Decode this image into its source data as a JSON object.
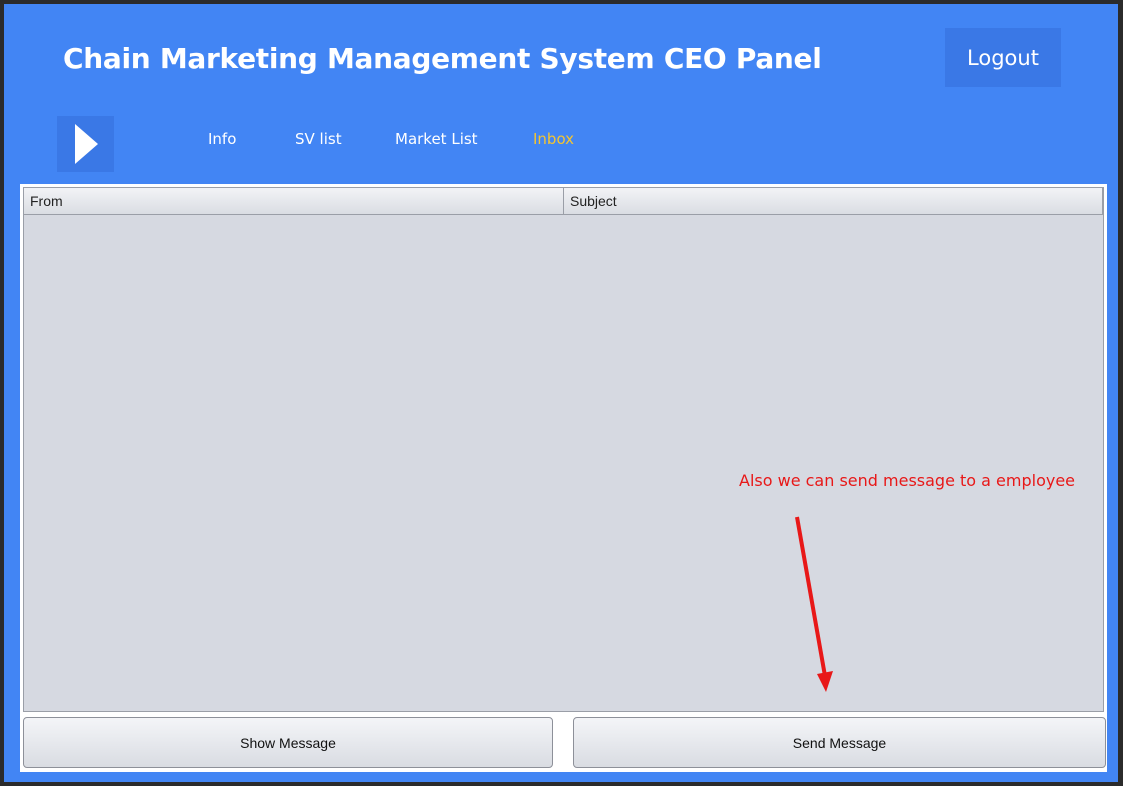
{
  "header": {
    "title": "Chain Marketing Management System CEO Panel",
    "logout_label": "Logout",
    "menu_icon": "play-triangle-icon"
  },
  "nav": {
    "items": [
      {
        "label": "Info",
        "active": false
      },
      {
        "label": "SV list",
        "active": false
      },
      {
        "label": "Market List",
        "active": false
      },
      {
        "label": "Inbox",
        "active": true
      }
    ]
  },
  "inbox_table": {
    "columns": [
      "From",
      "Subject"
    ],
    "rows": []
  },
  "actions": {
    "show_label": "Show Message",
    "send_label": "Send Message"
  },
  "annotation": {
    "text": "Also we can send message to a employee",
    "color": "#e81818"
  },
  "colors": {
    "background": "#4285f4",
    "button": "#3a78e6",
    "active_tab": "#f3c531"
  }
}
